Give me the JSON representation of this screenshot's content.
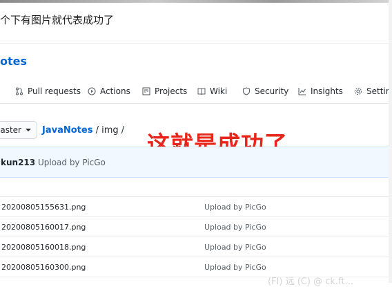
{
  "caption": "个下有图片就代表成功了",
  "repo_title": "otes",
  "tabs": [
    {
      "label": "Pull requests",
      "icon": "pull-request-icon"
    },
    {
      "label": "Actions",
      "icon": "play-circle-icon"
    },
    {
      "label": "Projects",
      "icon": "project-board-icon"
    },
    {
      "label": "Wiki",
      "icon": "book-icon"
    },
    {
      "label": "Security",
      "icon": "shield-icon"
    },
    {
      "label": "Insights",
      "icon": "graph-icon"
    },
    {
      "label": "Setting",
      "icon": "gear-icon"
    }
  ],
  "branch": "master",
  "breadcrumb": {
    "repo": "JavaNotes",
    "sep1": " / ",
    "folder": "img",
    "sep2": " /"
  },
  "overlay_text": "这就是成功了",
  "overlay_color": "#e8251a",
  "commit": {
    "author": "kun213",
    "message": "Upload by PicGo"
  },
  "files": [
    {
      "name": "20200805155631.png",
      "message": "Upload by PicGo"
    },
    {
      "name": "20200805160017.png",
      "message": "Upload by PicGo"
    },
    {
      "name": "20200805160018.png",
      "message": "Upload by PicGo"
    },
    {
      "name": "20200805160300.png",
      "message": "Upload by PicGo"
    }
  ],
  "watermark": "(FI) 远 (C) @ ck.ft..."
}
